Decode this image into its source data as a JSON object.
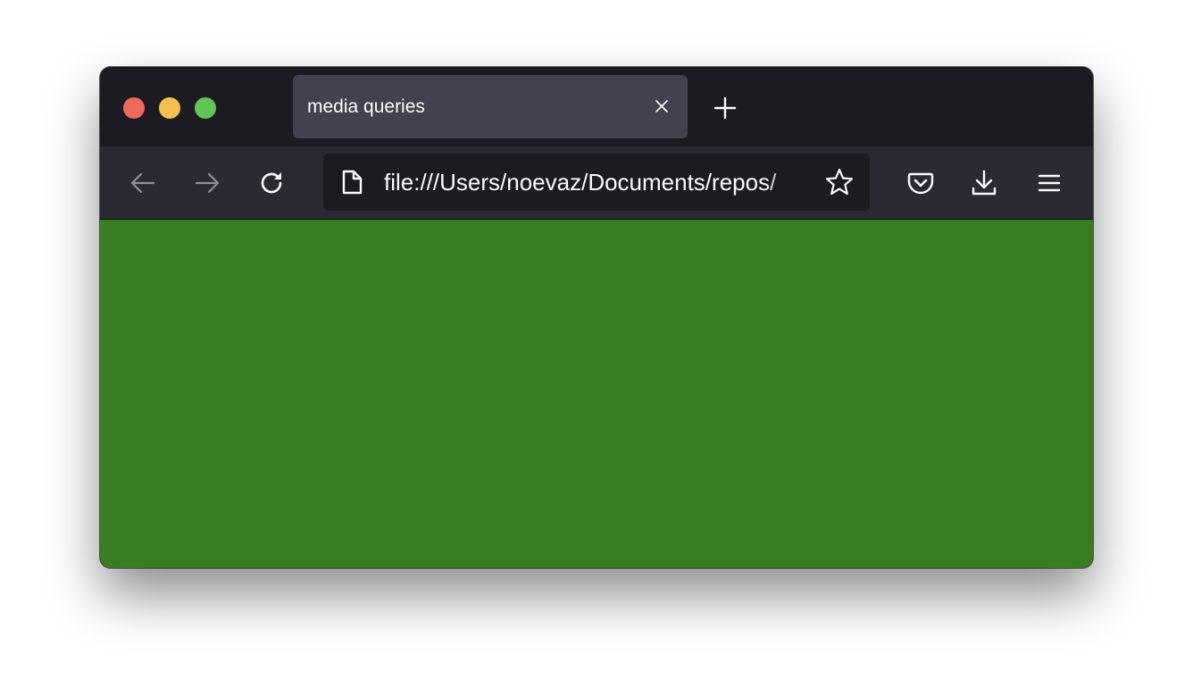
{
  "window": {
    "traffic_lights": [
      {
        "name": "close",
        "color": "#ec6a5e"
      },
      {
        "name": "minimize",
        "color": "#f4bf4f"
      },
      {
        "name": "zoom",
        "color": "#61c554"
      }
    ]
  },
  "tabs": [
    {
      "title": "media queries",
      "active": true,
      "close_icon": "close-icon"
    }
  ],
  "toolbar": {
    "new_tab_icon": "plus-icon",
    "back_icon": "arrow-left-icon",
    "forward_icon": "arrow-right-icon",
    "reload_icon": "reload-icon",
    "bookmark_icon": "star-icon",
    "pocket_icon": "pocket-icon",
    "downloads_icon": "download-icon",
    "menu_icon": "hamburger-menu-icon"
  },
  "urlbar": {
    "page_icon": "document-icon",
    "url": "file:///Users/noevaz/Documents/repos/"
  },
  "content": {
    "background_color": "#387d22"
  },
  "colors": {
    "chrome_dark": "#1c1b22",
    "toolbar": "#2b2a33",
    "tab_active": "#42414d",
    "icon": "#fbfbfe",
    "icon_disabled": "#8f8f9d"
  }
}
